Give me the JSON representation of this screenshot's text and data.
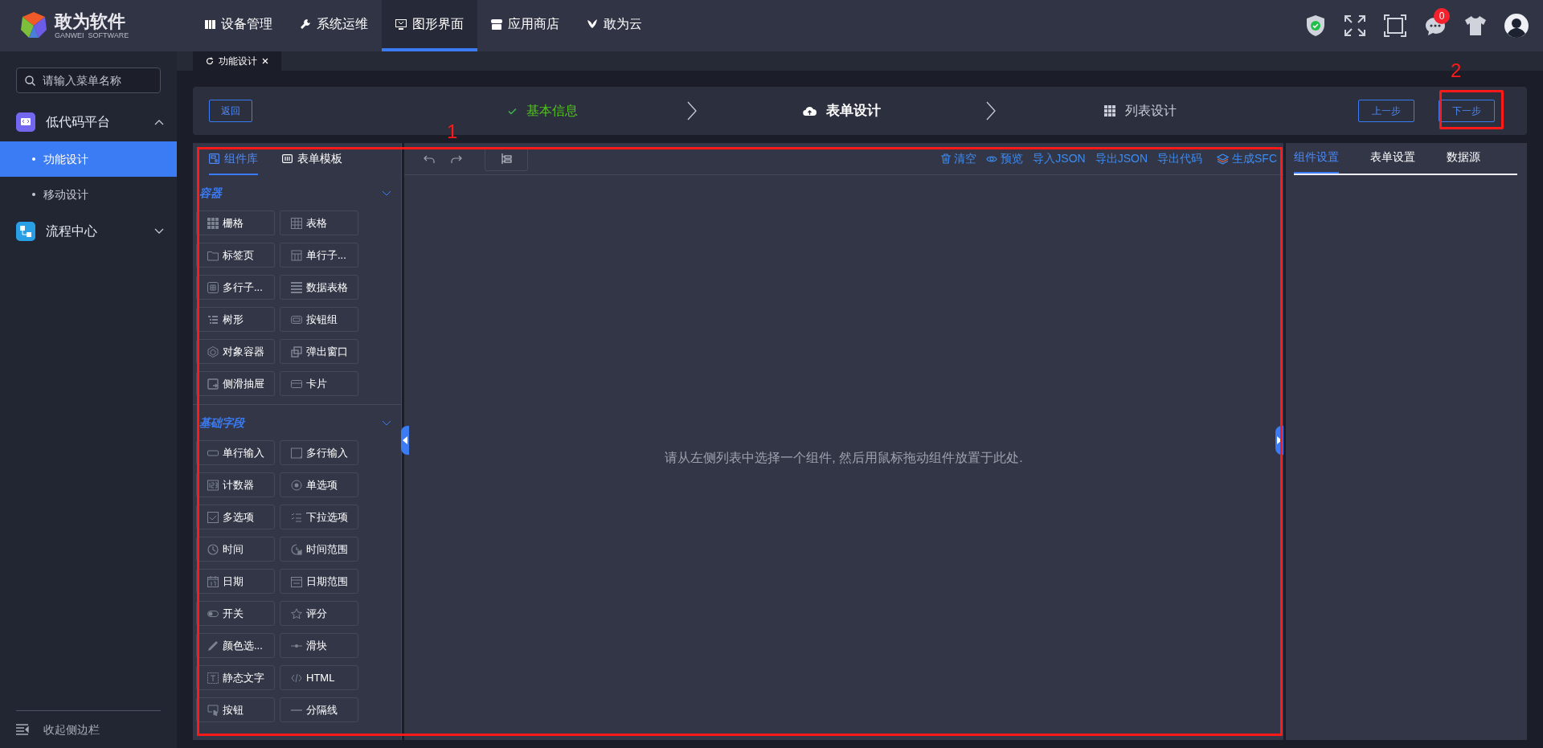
{
  "header": {
    "logo": {
      "title": "敢为软件",
      "subtitle": "GANWEI  SOFTWARE"
    },
    "nav": [
      {
        "label": "设备管理",
        "selected": false
      },
      {
        "label": "系统运维",
        "selected": false
      },
      {
        "label": "图形界面",
        "selected": true
      },
      {
        "label": "应用商店",
        "selected": false
      },
      {
        "label": "敢为云",
        "selected": false
      }
    ],
    "notification_count": "0"
  },
  "sidebar": {
    "search": {
      "placeholder": "请输入菜单名称"
    },
    "items": [
      {
        "label": "低代码平台",
        "expanded": true,
        "children": [
          {
            "label": "功能设计",
            "selected": true
          },
          {
            "label": "移动设计",
            "selected": false
          }
        ]
      },
      {
        "label": "流程中心",
        "expanded": false
      }
    ],
    "collapse": "收起侧边栏"
  },
  "tabs": [
    {
      "label": "功能设计",
      "selected": true
    }
  ],
  "steps": {
    "back": "返回",
    "items": [
      {
        "label": "基本信息",
        "done": true,
        "selected": false
      },
      {
        "label": "表单设计",
        "done": false,
        "selected": true
      },
      {
        "label": "列表设计",
        "done": false,
        "selected": false
      }
    ],
    "prev": "上一步",
    "next": "下一步"
  },
  "palette": {
    "tabs": [
      {
        "label": "组件库",
        "selected": true
      },
      {
        "label": "表单模板",
        "selected": false
      }
    ],
    "groups": [
      {
        "title": "容器",
        "expanded": true,
        "items": [
          "栅格",
          "表格",
          "标签页",
          "单行子...",
          "多行子...",
          "数据表格",
          "树形",
          "按钮组",
          "对象容器",
          "弹出窗口",
          "侧滑抽屉",
          "卡片"
        ]
      },
      {
        "title": "基础字段",
        "expanded": true,
        "items": [
          "单行输入",
          "多行输入",
          "计数器",
          "单选项",
          "多选项",
          "下拉选项",
          "时间",
          "时间范围",
          "日期",
          "日期范围",
          "开关",
          "评分",
          "颜色选...",
          "滑块",
          "静态文字",
          "HTML",
          "按钮",
          "分隔线"
        ]
      }
    ]
  },
  "canvas": {
    "actions": [
      "清空",
      "预览",
      "导入JSON",
      "导出JSON",
      "导出代码",
      "生成SFC"
    ],
    "empty_text": "请从左侧列表中选择一个组件, 然后用鼠标拖动组件放置于此处."
  },
  "settings": {
    "tabs": [
      {
        "label": "组件设置",
        "selected": true
      },
      {
        "label": "表单设置",
        "selected": false
      },
      {
        "label": "数据源",
        "selected": false
      }
    ]
  },
  "annotations": [
    {
      "label": "1"
    },
    {
      "label": "2"
    }
  ]
}
